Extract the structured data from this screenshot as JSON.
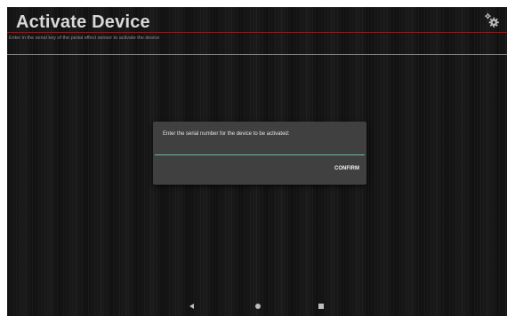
{
  "header": {
    "title": "Activate Device",
    "subtitle": "Enter in the serial key of the pedal effect sensor to activate the device",
    "settings_icon": "gear-icon"
  },
  "dialog": {
    "message": "Enter the serial number for the device to be activated:",
    "input_value": "",
    "confirm_label": "CONFIRM"
  },
  "navbar": {
    "icons": [
      "back-icon",
      "home-icon",
      "recents-icon"
    ]
  },
  "colors": {
    "background": "#161616",
    "title": "#d8d8d8",
    "accent_line": "#8a1f1f",
    "dialog_bg": "#404040",
    "input_underline": "#6fb4a8"
  }
}
